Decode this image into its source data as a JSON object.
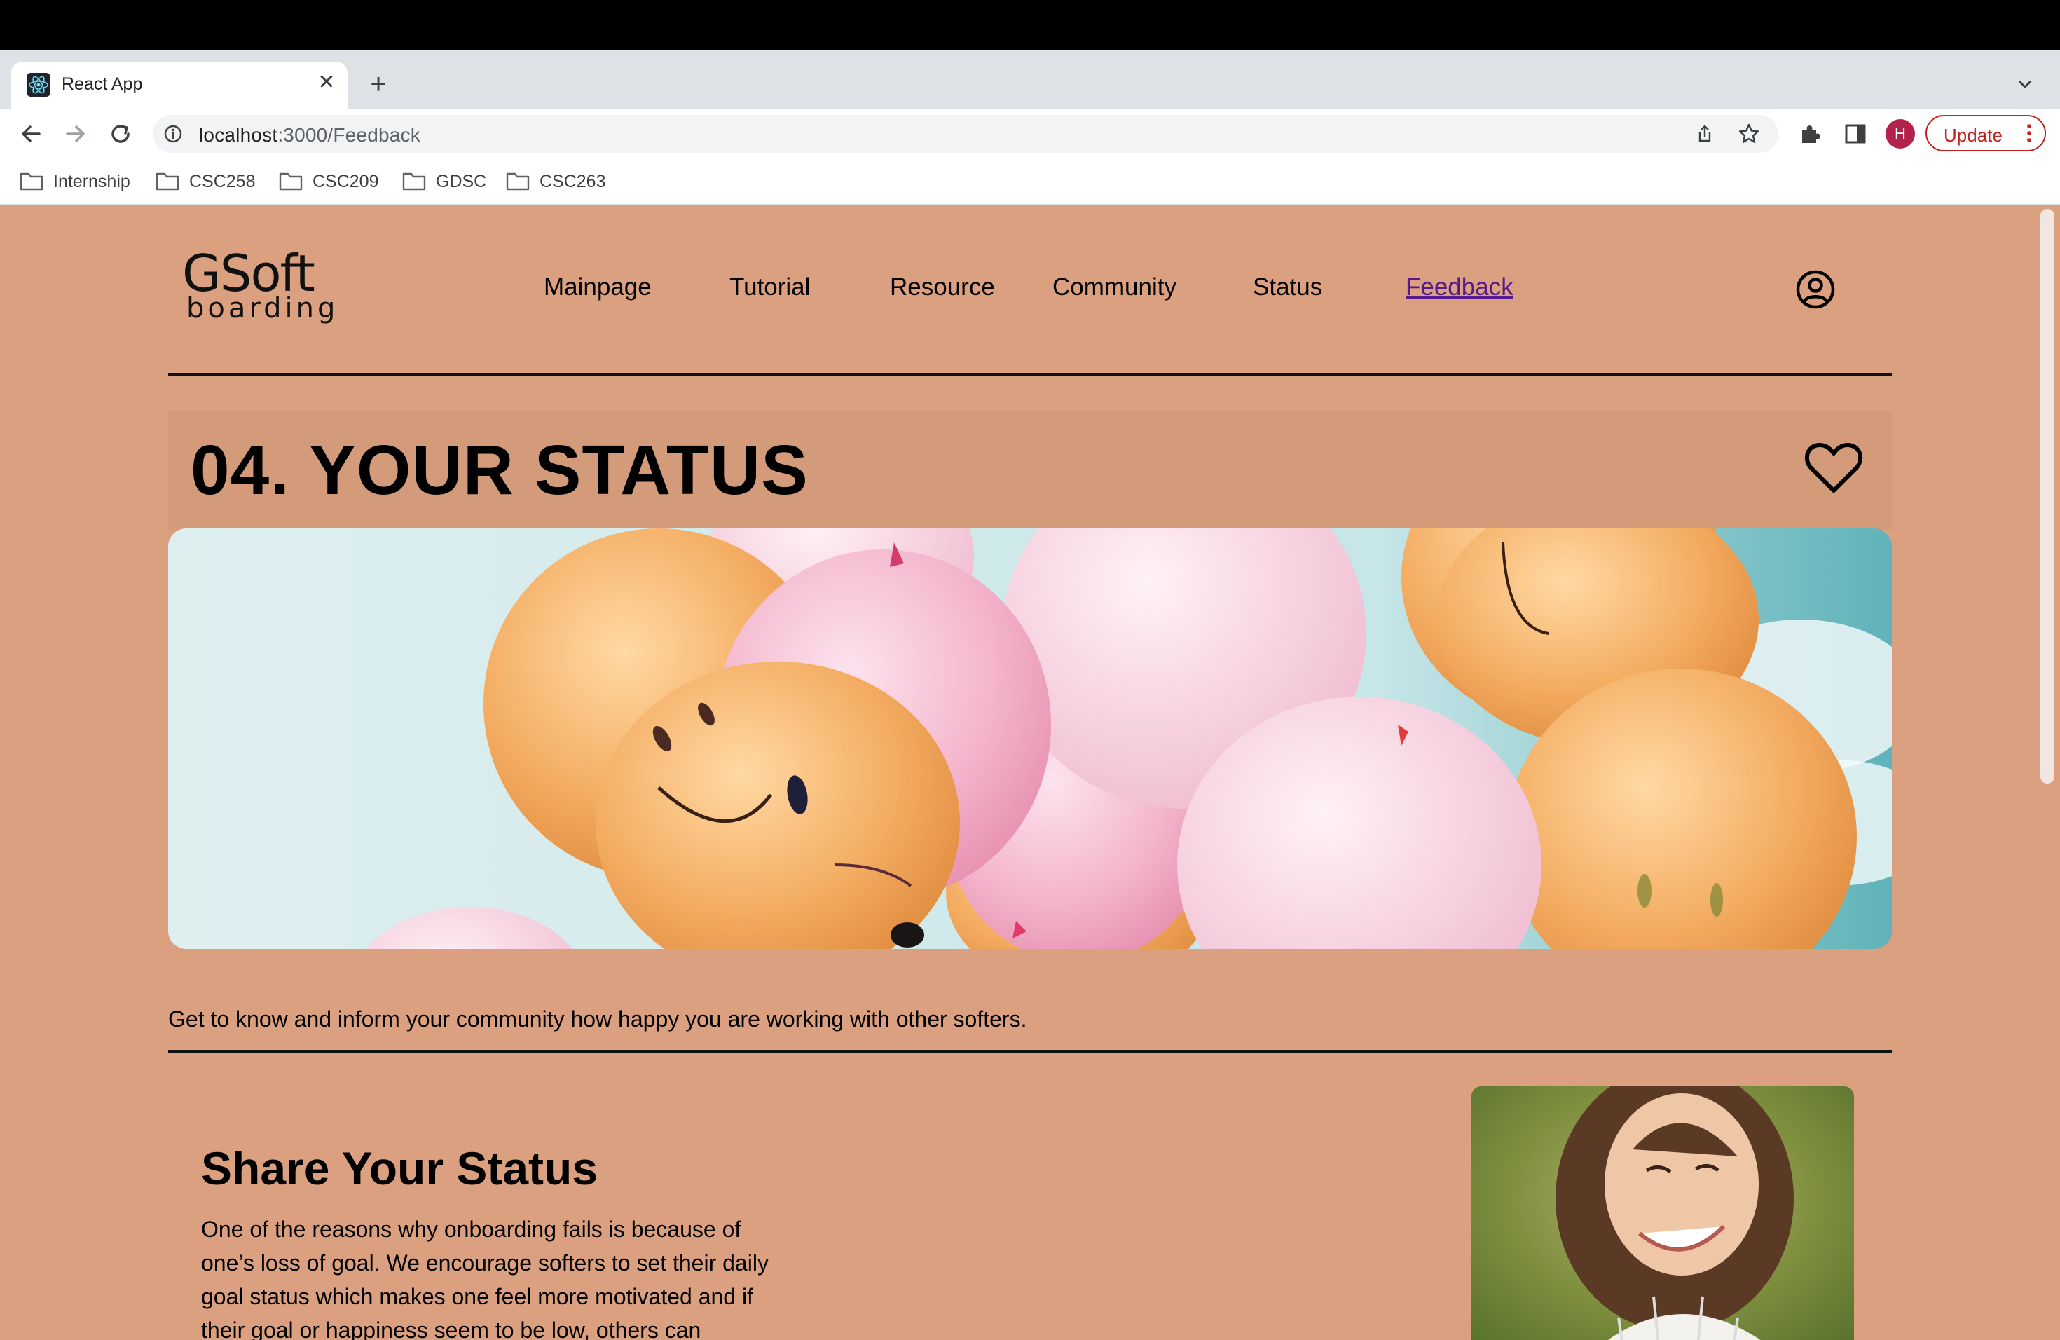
{
  "browser": {
    "tab_title": "React App",
    "url_host": "localhost",
    "url_path": ":3000/Feedback",
    "profile_initial": "H",
    "update_label": "Update",
    "bookmarks": [
      "Internship",
      "CSC258",
      "CSC209",
      "GDSC",
      "CSC263"
    ]
  },
  "site": {
    "logo_line1": "GSoft",
    "logo_line2": "boarding",
    "nav": [
      "Mainpage",
      "Tutorial",
      "Resource",
      "Community",
      "Status",
      "Feedback"
    ],
    "active_nav": "Feedback"
  },
  "hero": {
    "title": "04. YOUR STATUS",
    "tagline": "Get to know and inform your community how happy you are working with other softers."
  },
  "share": {
    "title": "Share Your Status",
    "body": "One of the reasons why onboarding fails is because of one’s loss of goal. We encourage softers to set their daily goal status which makes one feel more motivated and if their goal or happiness seem to be low, others can recognize to support them."
  },
  "colors": {
    "page_bg": "#dba07f",
    "status_band": "#d49b7b",
    "active_link": "#551a8b",
    "update_red": "#c5221f"
  }
}
